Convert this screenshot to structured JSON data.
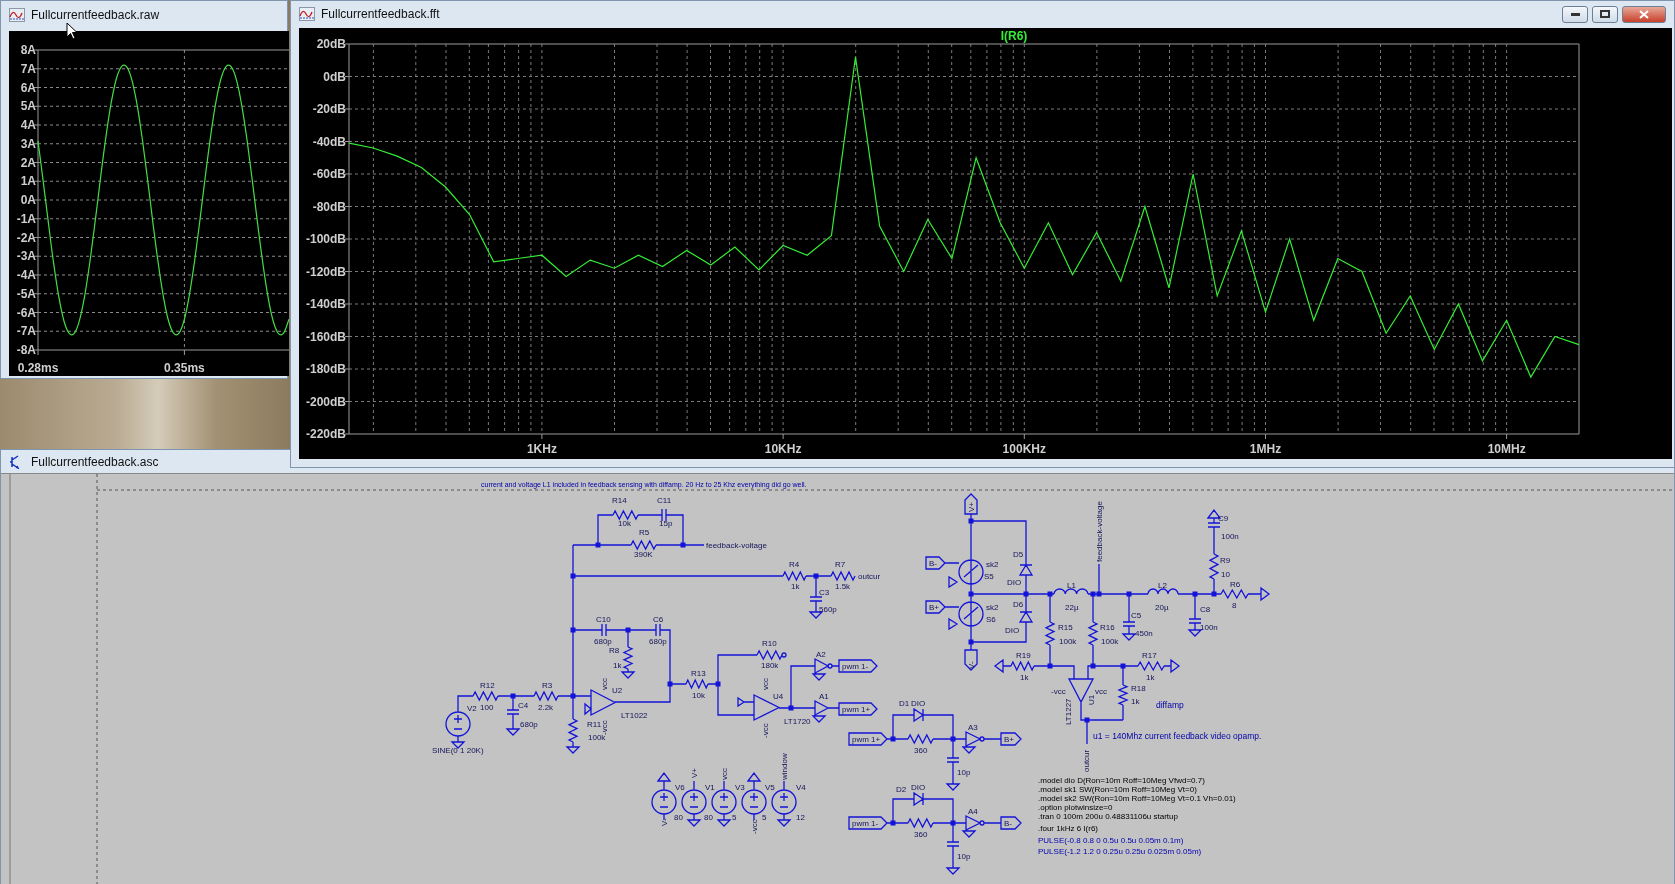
{
  "waveform_window": {
    "title": "Fullcurrentfeedback.raw",
    "chart_data": {
      "type": "line",
      "grid": true,
      "xlim": [
        0.28,
        0.4
      ],
      "ylim": [
        -8,
        8
      ],
      "xticks": [
        {
          "value": 0.28,
          "label": "0.28ms"
        },
        {
          "value": 0.35,
          "label": "0.35ms"
        }
      ],
      "yticks": [
        {
          "value": 8,
          "label": "8A"
        },
        {
          "value": 7,
          "label": "7A"
        },
        {
          "value": 6,
          "label": "6A"
        },
        {
          "value": 5,
          "label": "5A"
        },
        {
          "value": 4,
          "label": "4A"
        },
        {
          "value": 3,
          "label": "3A"
        },
        {
          "value": 2,
          "label": "2A"
        },
        {
          "value": 1,
          "label": "1A"
        },
        {
          "value": 0,
          "label": "0A"
        },
        {
          "value": -1,
          "label": "-1A"
        },
        {
          "value": -2,
          "label": "-2A"
        },
        {
          "value": -3,
          "label": "-3A"
        },
        {
          "value": -4,
          "label": "-4A"
        },
        {
          "value": -5,
          "label": "-5A"
        },
        {
          "value": -6,
          "label": "-6A"
        },
        {
          "value": -7,
          "label": "-7A"
        },
        {
          "value": -8,
          "label": "-8A"
        }
      ],
      "x": [
        0.28,
        0.2825,
        0.285,
        0.2875,
        0.29,
        0.2925,
        0.295,
        0.2975,
        0.3,
        0.3025,
        0.305,
        0.3075,
        0.31,
        0.3125,
        0.315,
        0.3175,
        0.32,
        0.3225,
        0.325,
        0.3275,
        0.33,
        0.3325,
        0.335,
        0.3375,
        0.34,
        0.3425,
        0.345,
        0.3475,
        0.35,
        0.3525,
        0.355,
        0.3575,
        0.36,
        0.3625,
        0.365,
        0.3675,
        0.37,
        0.3725,
        0.375,
        0.3775,
        0.38,
        0.3825,
        0.385,
        0.3875,
        0.39,
        0.3925,
        0.395,
        0.3975,
        0.4
      ],
      "series": [
        {
          "color": "#44dd44",
          "values": [
            3.14,
            0.99,
            -1.26,
            -3.39,
            -5.19,
            -6.48,
            -7.13,
            -7.09,
            -6.35,
            -4.99,
            -3.14,
            -0.99,
            1.26,
            3.39,
            5.19,
            6.48,
            7.13,
            7.09,
            6.35,
            4.99,
            3.14,
            0.99,
            -1.26,
            -3.39,
            -5.19,
            -6.48,
            -7.13,
            -7.09,
            -6.35,
            -4.99,
            -3.14,
            -0.99,
            1.26,
            3.39,
            5.19,
            6.48,
            7.13,
            7.09,
            6.35,
            4.99,
            3.14,
            0.99,
            -1.26,
            -3.39,
            -5.19,
            -6.48,
            -7.13,
            -7.09,
            -6.35
          ]
        }
      ]
    }
  },
  "fft_window": {
    "title": "Fullcurrentfeedback.fft",
    "chart_data": {
      "type": "line",
      "grid": true,
      "ylim": [
        -220,
        20
      ],
      "categories": [
        null,
        null,
        null,
        null,
        null,
        null,
        null,
        null,
        "1KHz",
        null,
        null,
        null,
        null,
        null,
        null,
        null,
        null,
        null,
        "10KHz",
        null,
        null,
        null,
        null,
        null,
        null,
        null,
        null,
        null,
        "100KHz",
        null,
        null,
        null,
        null,
        null,
        null,
        null,
        null,
        null,
        "1MHz",
        null,
        null,
        null,
        null,
        null,
        null,
        null,
        null,
        null,
        "10MHz",
        null,
        null,
        null
      ],
      "yticks": [
        {
          "value": 20,
          "label": "20dB"
        },
        {
          "value": 0,
          "label": "0dB"
        },
        {
          "value": -20,
          "label": "-20dB"
        },
        {
          "value": -40,
          "label": "-40dB"
        },
        {
          "value": -60,
          "label": "-60dB"
        },
        {
          "value": -80,
          "label": "-80dB"
        },
        {
          "value": -100,
          "label": "-100dB"
        },
        {
          "value": -120,
          "label": "-120dB"
        },
        {
          "value": -140,
          "label": "-140dB"
        },
        {
          "value": -160,
          "label": "-160dB"
        },
        {
          "value": -180,
          "label": "-180dB"
        },
        {
          "value": -200,
          "label": "-200dB"
        },
        {
          "value": -220,
          "label": "-220dB"
        }
      ],
      "series": [
        {
          "name": "I(R6)",
          "color": "#33ee33",
          "values": [
            -41,
            -44,
            -49,
            -56,
            -68,
            -85,
            -114,
            -112,
            -110,
            -123,
            -113,
            -118,
            -110,
            -117,
            -107,
            -116,
            -105,
            -119,
            -104,
            -110,
            -98,
            12,
            -92,
            -120,
            -88,
            -112,
            -50,
            -90,
            -118,
            -90,
            -122,
            -96,
            -126,
            -80,
            -130,
            -60,
            -135,
            -95,
            -145,
            -100,
            -150,
            -112,
            -120,
            -158,
            -135,
            -168,
            -140,
            -175,
            -150,
            -185,
            -160,
            -165
          ]
        }
      ]
    }
  },
  "schematic_window": {
    "title": "Fullcurrentfeedback.asc",
    "comment": "current and voltage L1 included in  feedback sensing with diffamp. 20 Hz to 25 Khz everything did go well.",
    "labels": [
      "R14",
      "C11",
      "10k",
      "15p",
      "R5",
      "390K",
      "feedback-voltage",
      "R4",
      "R7",
      "outcur",
      "1k",
      "1.5k",
      "C3",
      "560p",
      "C10",
      "C6",
      "680p",
      "680p",
      "R8",
      "1k",
      "R10",
      "180k",
      "A2",
      "pwm 1-",
      "R13",
      "10k",
      "R12",
      "R3",
      "vcc",
      "U2",
      "V2",
      "100",
      "C4",
      "2.2k",
      "LT1022",
      "-vcc",
      "680p",
      "R11",
      "100k",
      "SINE(0 1 20K)",
      "vcc",
      "U4",
      "A1",
      "pwm 1+",
      "LT1720",
      "-vcc",
      "D1",
      "DIO",
      "pwm 1+",
      "360",
      "A3",
      "B+",
      "10p",
      "D2",
      "DIO",
      "pwm 1-",
      "360",
      "A4",
      "B-",
      "10p",
      "V6",
      "V+",
      "V1",
      "vcc",
      "V3",
      "V5",
      "window",
      "V4",
      "V-",
      "80",
      "80",
      "5",
      "-vcc",
      "5",
      "12",
      "V+",
      "feedback-voltage",
      "C9",
      "100n",
      "D5",
      "R9",
      "B-",
      "sk2",
      "S5",
      "10",
      "DIO",
      "L1",
      "L2",
      "R6",
      "D6",
      "22µ",
      "20µ",
      "8",
      "B+",
      "sk2",
      "S6",
      "C8",
      "C5",
      "R15",
      "R16",
      "DIO",
      "100n",
      "450n",
      "100k",
      "100k",
      "R19",
      "R17",
      "V-",
      "1k",
      "1k",
      "R18",
      "-vcc",
      "vcc",
      "1k",
      "U1",
      "LT1227",
      "diffamp",
      "u1 = 140Mhz current feedback video opamp.",
      "outcur"
    ],
    "directives": [
      {
        "kind": "directive",
        "text": ".model dio D(Ron=10m  Roff=10Meg Vfwd=0.7)"
      },
      {
        "kind": "directive",
        "text": ".model sk1 SW(Ron=10m  Roff=10Meg Vt=0)"
      },
      {
        "kind": "directive",
        "text": ".model sk2 SW(Ron=10m  Roff=10Meg Vt=0.1 Vh=0.01)"
      },
      {
        "kind": "directive",
        "text": ".option plotwinsize=0"
      },
      {
        "kind": "directive",
        "text": ".tran 0 100m 200u 0.48831106u startup"
      },
      {
        "kind": "directive",
        "text": ".four 1kHz 6  I(r6)"
      },
      {
        "kind": "comment",
        "text": "PULSE(-0.8 0.8 0 0.5u 0.5u 0.05m 0.1m)"
      },
      {
        "kind": "comment",
        "text": "PULSE(-1.2 1.2 0 0.25u 0.25u 0.025m 0.05m)"
      }
    ]
  }
}
